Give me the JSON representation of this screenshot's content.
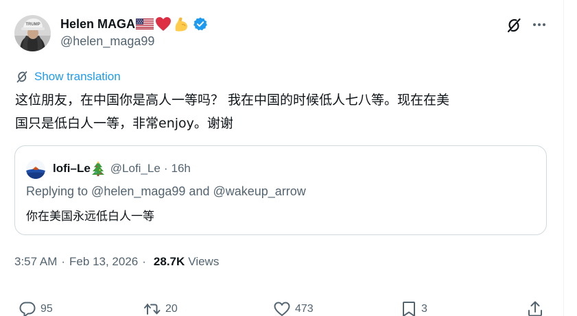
{
  "post": {
    "author": {
      "display_name": "Helen MAGA",
      "name_emojis": [
        "us-flag-emoji",
        "red-heart-emoji",
        "flexed-biceps-emoji"
      ],
      "verified": true,
      "handle": "@helen_maga99",
      "avatar_cap_text": "TRUMP"
    },
    "translate_label": "Show translation",
    "text_lines": [
      "这位朋友，在中国你是高人一等吗？ 我在中国的时候低人七八等。现在在美",
      "国只是低白人一等，非常enjoy。谢谢"
    ],
    "quote": {
      "display_name": "lofi–Le",
      "name_emoji": "christmas-tree-emoji",
      "handle": "@Lofi_Le",
      "separator": "·",
      "time": "16h",
      "replying_to": "Replying to @helen_maga99 and @wakeup_arrow",
      "text": "你在美国永远低白人一等"
    },
    "meta": {
      "time": "3:57 AM",
      "separator": "·",
      "date": "Feb 13, 2026",
      "views_count": "28.7K",
      "views_label": "Views"
    },
    "actions": {
      "replies": "95",
      "reposts": "20",
      "likes": "473",
      "bookmarks": "3"
    }
  },
  "colors": {
    "text_primary": "#0f1419",
    "text_secondary": "#536471",
    "accent_blue": "#1d9bf0",
    "border": "#cfd9de"
  },
  "icons": {
    "grok": "grok-icon",
    "more": "more-icon",
    "translate": "translate-icon",
    "reply": "reply-icon",
    "repost": "repost-icon",
    "like": "heart-icon",
    "bookmark": "bookmark-icon",
    "share": "share-icon"
  }
}
